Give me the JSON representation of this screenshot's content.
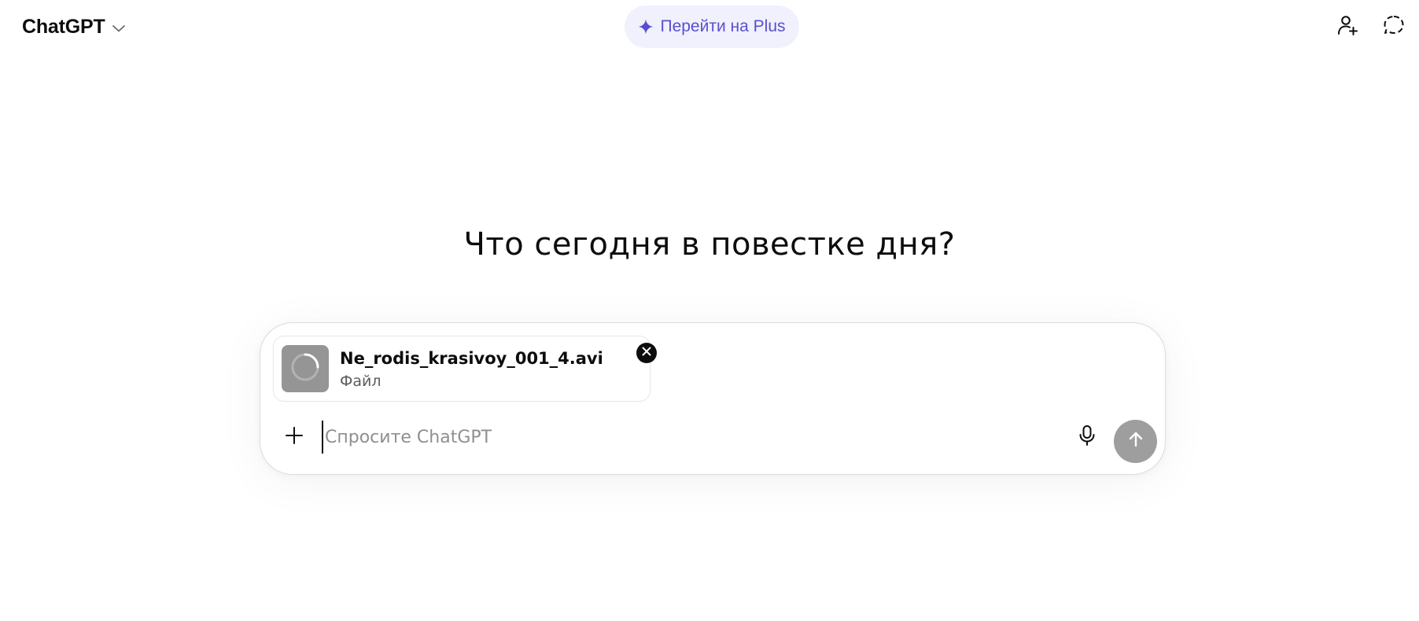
{
  "header": {
    "model_name": "ChatGPT",
    "upgrade_label": "Перейти на Plus",
    "accent_color": "#5a4fcf",
    "icons": {
      "model_dropdown": "chevron-down-icon",
      "upgrade": "sparkle-icon",
      "add_person": "add-person-icon",
      "temporary_chat": "dashed-chat-icon"
    }
  },
  "main": {
    "headline": "Что сегодня в повестке дня?"
  },
  "composer": {
    "attachment": {
      "file_name": "Ne_rodis_krasivoy_001_4.avi",
      "file_type": "Файл",
      "status_icon": "loading-spinner-icon",
      "remove_icon": "close-icon"
    },
    "input_placeholder": "Спросите ChatGPT",
    "input_value": "",
    "icons": {
      "add": "plus-icon",
      "voice": "microphone-icon",
      "send": "arrow-up-icon"
    }
  }
}
